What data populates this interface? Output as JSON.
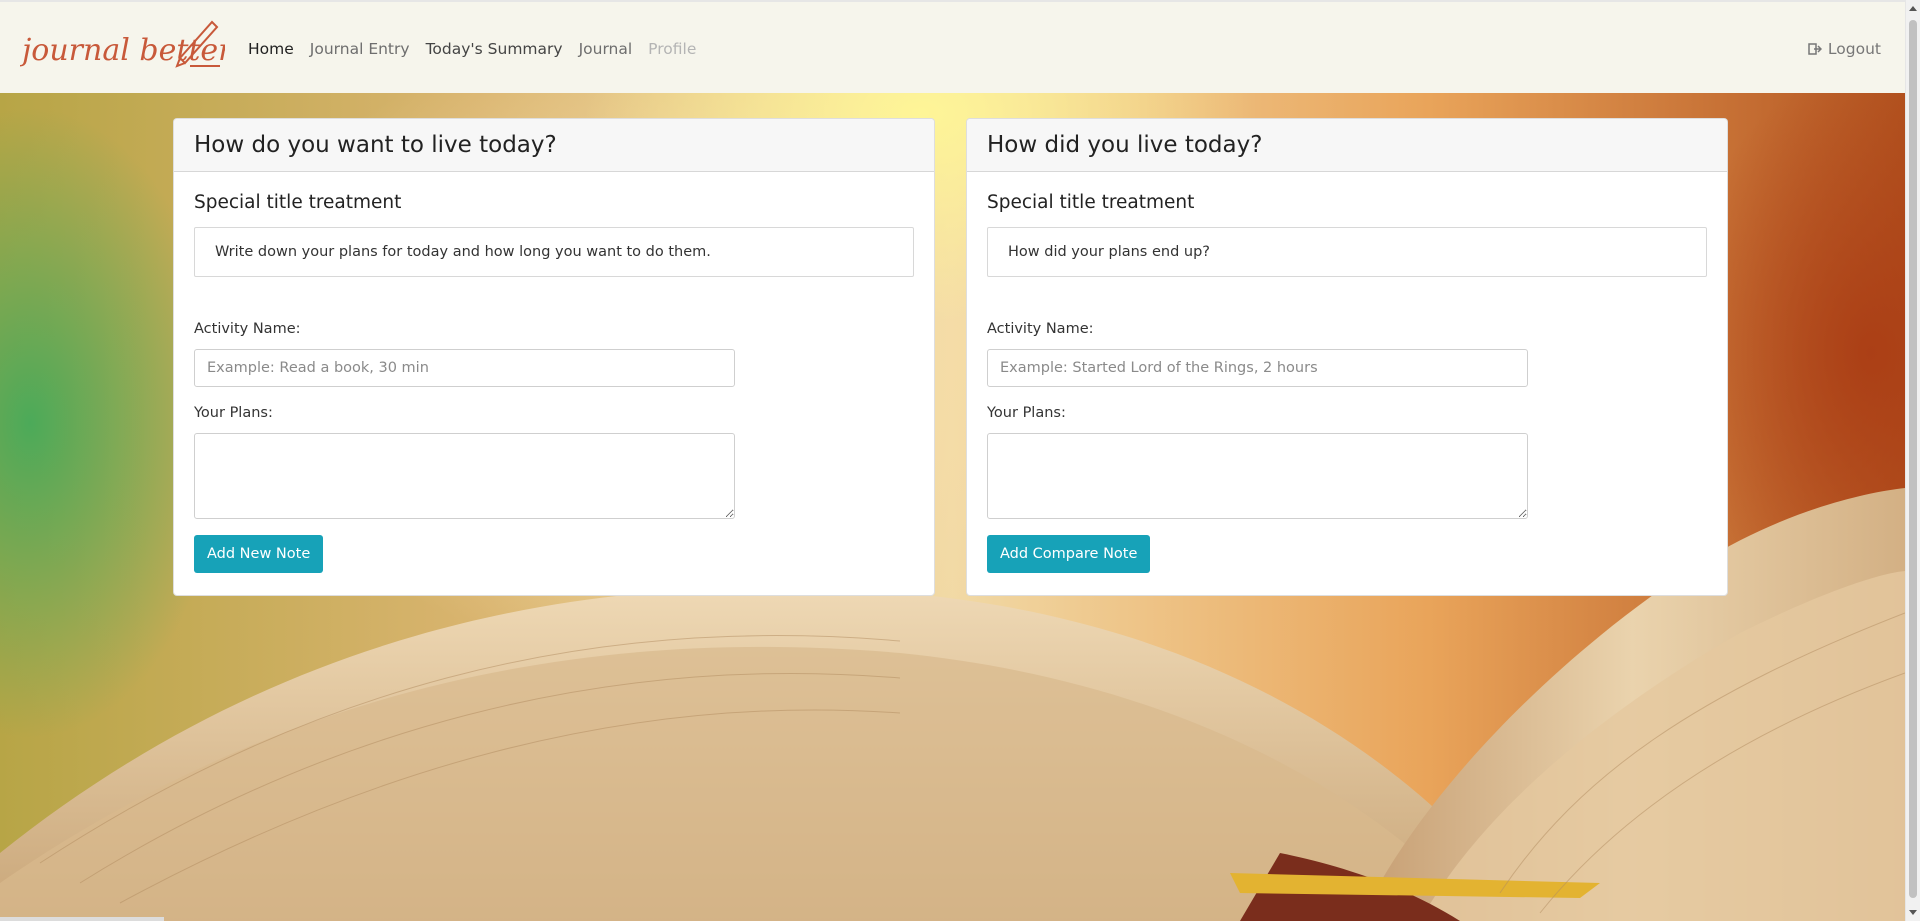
{
  "nav": {
    "brand": "journal better",
    "links": [
      {
        "label": "Home"
      },
      {
        "label": "Journal Entry"
      },
      {
        "label": "Today's Summary"
      },
      {
        "label": "Journal"
      },
      {
        "label": "Profile"
      }
    ],
    "logout": "Logout",
    "logout_icon": "sign-out-icon"
  },
  "cards": {
    "left": {
      "header": "How do you want to live today?",
      "title": "Special title treatment",
      "text": "Write down your plans for today and how long you want to do them.",
      "activity_label": "Activity Name:",
      "activity_placeholder": "Example: Read a book, 30 min",
      "activity_value": "",
      "plans_label": "Your Plans:",
      "plans_value": "",
      "button": "Add New Note"
    },
    "right": {
      "header": "How did you live today?",
      "title": "Special title treatment",
      "text": "How did your plans end up?",
      "activity_label": "Activity Name:",
      "activity_placeholder": "Example: Started Lord of the Rings, 2 hours",
      "activity_value": "",
      "plans_label": "Your Plans:",
      "plans_value": "",
      "button": "Add Compare Note"
    }
  },
  "colors": {
    "navbar_bg": "#f6f5ec",
    "brand": "#c8593a",
    "button": "#17a2b8"
  }
}
